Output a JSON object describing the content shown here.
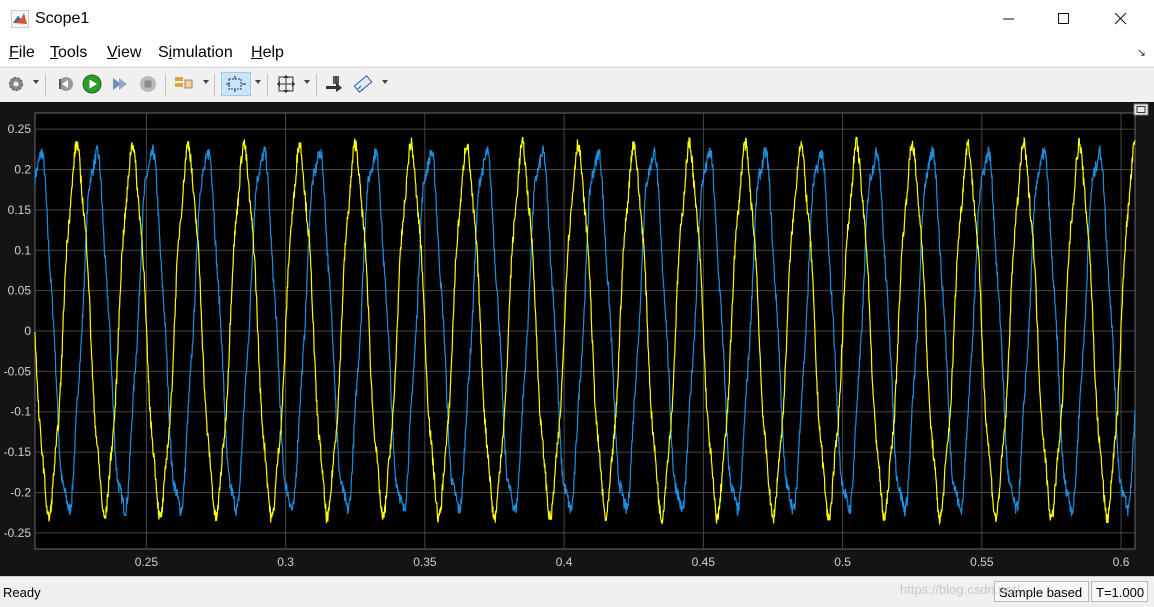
{
  "window": {
    "title": "Scope1"
  },
  "menu": {
    "file": {
      "lead": "F",
      "rest": "ile"
    },
    "tools": {
      "lead": "T",
      "rest": "ools"
    },
    "view": {
      "lead": "V",
      "rest": "iew"
    },
    "simulation": {
      "pre": "S",
      "lead": "i",
      "rest": "mulation"
    },
    "help": {
      "lead": "H",
      "rest": "elp"
    }
  },
  "toolbar": {
    "icons": [
      "gear-icon",
      "step-back-icon",
      "run-icon",
      "step-forward-icon",
      "stop-icon",
      "signal-selector-icon",
      "zoom-icon",
      "autoscale-icon",
      "highlight-icon",
      "measurements-icon"
    ],
    "zoom_active": true
  },
  "status": {
    "ready": "Ready",
    "mode": "Sample based",
    "time": "T=1.000"
  },
  "watermark": "https://blog.csdn.net/...",
  "colors": {
    "plot_bg": "#000000",
    "figure_bg": "#141414",
    "grid": "#474747",
    "series_yellow": "#ffff00",
    "series_blue": "#0072bd",
    "axis_text": "#cfcfcf"
  },
  "chart_data": {
    "type": "line",
    "title": "",
    "xlabel": "",
    "ylabel": "",
    "xlim": [
      0.21,
      0.605
    ],
    "ylim": [
      -0.27,
      0.27
    ],
    "xticks": [
      0.25,
      0.3,
      0.35,
      0.4,
      0.45,
      0.5,
      0.55,
      0.6
    ],
    "xtick_labels": [
      "0.25",
      "0.3",
      "0.35",
      "0.4",
      "0.45",
      "0.5",
      "0.55",
      "0.6"
    ],
    "yticks": [
      0.25,
      0.2,
      0.15,
      0.1,
      0.05,
      0,
      -0.05,
      -0.1,
      -0.15,
      -0.2,
      -0.25
    ],
    "ytick_labels": [
      "0.25",
      "0.2",
      "0.15",
      "0.1",
      "0.05",
      "0",
      "-0.05",
      "-0.1",
      "-0.15",
      "-0.2",
      "-0.25"
    ],
    "grid": true,
    "series": [
      {
        "color": "yellow",
        "amplitude": 0.22,
        "frequency_hz": 50,
        "phase_deg": 0
      },
      {
        "color": "blue",
        "amplitude": 0.22,
        "frequency_hz": 50,
        "phase_deg": -120
      }
    ]
  }
}
